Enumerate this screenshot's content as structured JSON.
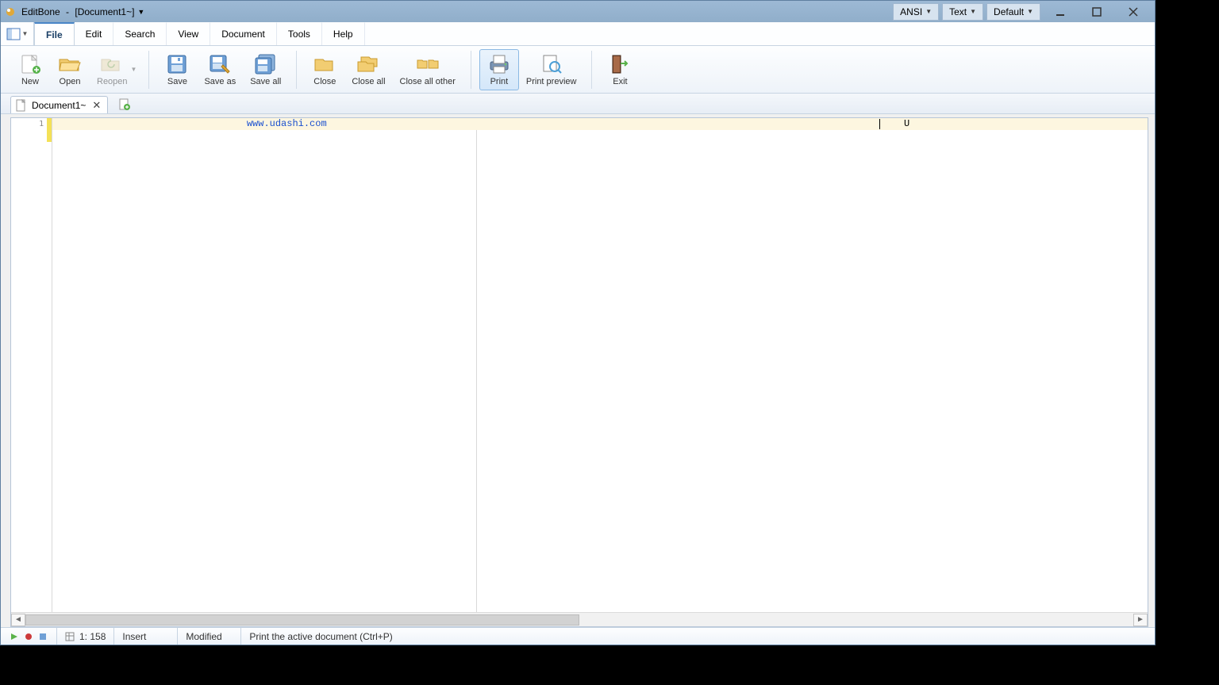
{
  "titlebar": {
    "app_name": "EditBone",
    "doc_name": "[Document1~]",
    "dd_encoding": "ANSI",
    "dd_type": "Text",
    "dd_highlighter": "Default"
  },
  "menu": {
    "tabs": [
      "File",
      "Edit",
      "Search",
      "View",
      "Document",
      "Tools",
      "Help"
    ],
    "active_index": 0
  },
  "ribbon": {
    "new": "New",
    "open": "Open",
    "reopen": "Reopen",
    "save": "Save",
    "saveas": "Save as",
    "saveall": "Save all",
    "close": "Close",
    "closeall": "Close all",
    "closeallother": "Close all other",
    "print": "Print",
    "printpreview": "Print preview",
    "exit": "Exit"
  },
  "tabbar": {
    "doc_name": "Document1~"
  },
  "editor": {
    "line_number": "1",
    "content_left_pad": "                                  ",
    "url_text": "www.udashi.com",
    "content_right_pad": "                                                                                                     U"
  },
  "status": {
    "position": "1: 158",
    "mode": "Insert",
    "modified": "Modified",
    "hint": "Print the active document (Ctrl+P)"
  }
}
